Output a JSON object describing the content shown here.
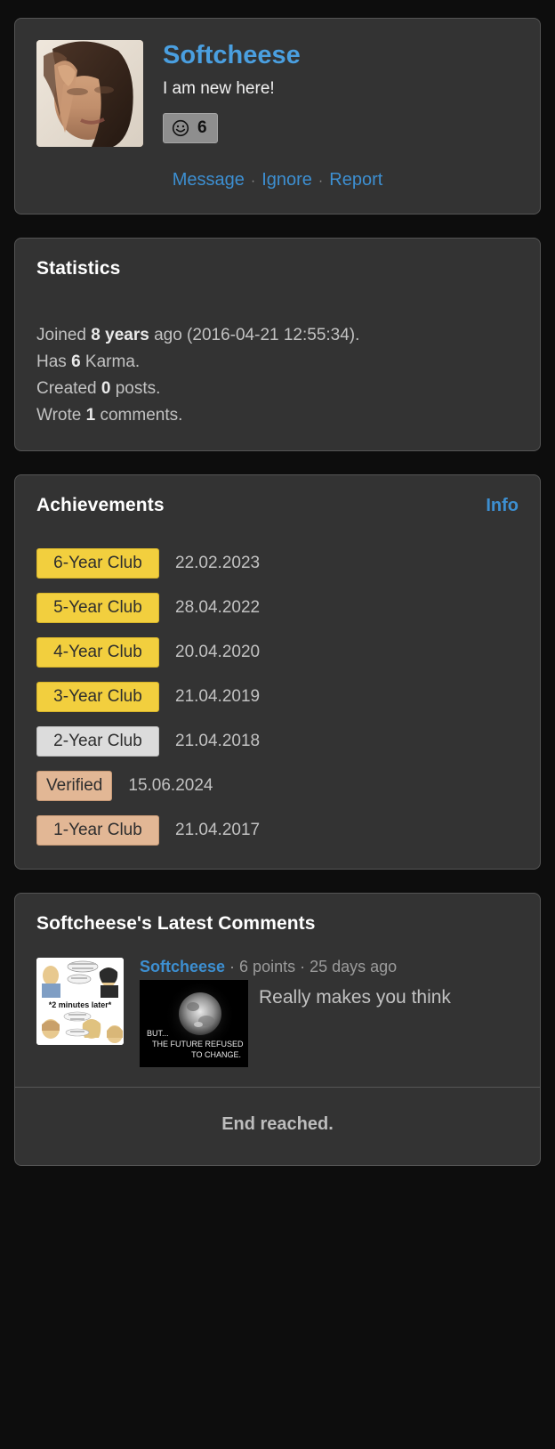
{
  "profile": {
    "username": "Softcheese",
    "tagline": "I am new here!",
    "karma_icon": "smiley-face-icon",
    "karma_value": "6",
    "avatar_alt": "user-avatar-photo",
    "links": [
      {
        "label": "Message",
        "name": "message-link"
      },
      {
        "label": "Ignore",
        "name": "ignore-link"
      },
      {
        "label": "Report",
        "name": "report-link"
      }
    ],
    "separator": "·"
  },
  "statistics": {
    "title": "Statistics",
    "lines": [
      {
        "prefix": "Joined ",
        "strong": "8 years",
        "suffix": " ago (2016-04-21 12:55:34)."
      },
      {
        "prefix": "Has ",
        "strong": "6",
        "suffix": " Karma."
      },
      {
        "prefix": "Created ",
        "strong": "0",
        "suffix": " posts."
      },
      {
        "prefix": "Wrote ",
        "strong": "1",
        "suffix": " comments."
      }
    ]
  },
  "achievements": {
    "title": "Achievements",
    "info_label": "Info",
    "items": [
      {
        "label": "6-Year Club",
        "date": "22.02.2023",
        "tier": "gold",
        "wide": true
      },
      {
        "label": "5-Year Club",
        "date": "28.04.2022",
        "tier": "gold",
        "wide": true
      },
      {
        "label": "4-Year Club",
        "date": "20.04.2020",
        "tier": "gold",
        "wide": true
      },
      {
        "label": "3-Year Club",
        "date": "21.04.2019",
        "tier": "gold",
        "wide": true
      },
      {
        "label": "2-Year Club",
        "date": "21.04.2018",
        "tier": "silver",
        "wide": true
      },
      {
        "label": "Verified",
        "date": "15.06.2024",
        "tier": "bronze",
        "wide": false
      },
      {
        "label": "1-Year Club",
        "date": "21.04.2017",
        "tier": "bronze",
        "wide": true
      }
    ]
  },
  "comments": {
    "title": "Softcheese's Latest Comments",
    "items": [
      {
        "thumbnail_alt": "comic-thumbnail",
        "thumbnail_caption": "*2 minutes later*",
        "author": "Softcheese",
        "points": "6 points",
        "age": "25 days ago",
        "separator": "·",
        "embed_alt": "moon-meme-image",
        "embed_line1": "BUT...",
        "embed_line2": "THE FUTURE REFUSED",
        "embed_line3": "TO CHANGE.",
        "text": "Really makes you think"
      }
    ],
    "end_label": "End reached."
  },
  "colors": {
    "background": "#0d0d0d",
    "panel": "#333333",
    "panel_border": "#555555",
    "link": "#3d8fd1",
    "username": "#4a9fe0",
    "body_text": "#c2c2c2",
    "gold": "#f2cf3e",
    "silver": "#dcdcdc",
    "bronze": "#e2b795"
  }
}
